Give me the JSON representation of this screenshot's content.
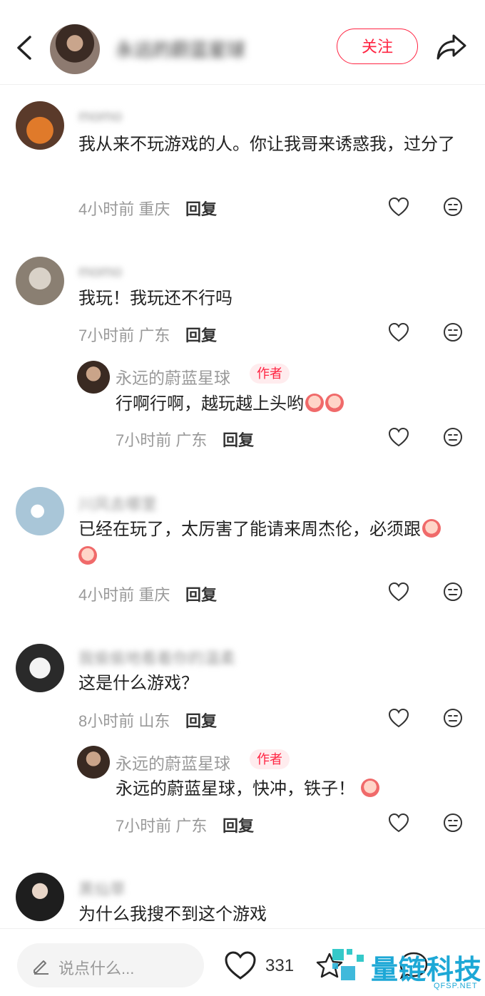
{
  "header": {
    "author_name": "永远的蔚蓝星球",
    "follow_label": "关注"
  },
  "comments": [
    {
      "user": "momo",
      "text": "我从来不玩游戏的人。你让我哥来诱惑我，过分了",
      "time": "4小时前",
      "location": "重庆",
      "reply_label": "回复"
    },
    {
      "user": "momo",
      "text": "我玩！我玩还不行吗",
      "time": "7小时前",
      "location": "广东",
      "reply_label": "回复",
      "replies": [
        {
          "user": "永远的蔚蓝星球",
          "tag": "作者",
          "text": "行啊行啊，越玩越上头哟",
          "time": "7小时前",
          "location": "广东",
          "reply_label": "回复"
        }
      ]
    },
    {
      "user": "川风去哪里",
      "text": "已经在玩了，太厉害了能请来周杰伦，必须跟",
      "time": "4小时前",
      "location": "重庆",
      "reply_label": "回复"
    },
    {
      "user": "我偷偷地看着你的温柔",
      "text": "这是什么游戏？",
      "time": "8小时前",
      "location": "山东",
      "reply_label": "回复",
      "replies": [
        {
          "user": "永远的蔚蓝星球",
          "tag": "作者",
          "text": "永远的蔚蓝星球，快冲，铁子！",
          "time": "7小时前",
          "location": "广东",
          "reply_label": "回复"
        }
      ]
    },
    {
      "user": "黑仙草",
      "text": "为什么我搜不到这个游戏"
    }
  ],
  "bottom_bar": {
    "input_placeholder": "说点什么...",
    "like_count": "331"
  },
  "watermark": {
    "text": "量链科技",
    "sub": "QFSP.NET"
  }
}
